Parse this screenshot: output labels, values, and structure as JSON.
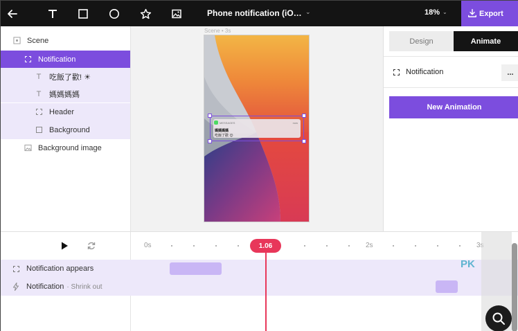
{
  "toolbar": {
    "doc_title": "Phone notification (iO…",
    "zoom": "18%",
    "export_label": "Export",
    "icons": [
      "back-arrow-icon",
      "text-tool-icon",
      "rectangle-tool-icon",
      "ellipse-tool-icon",
      "star-tool-icon",
      "image-tool-icon"
    ]
  },
  "layers": [
    {
      "label": "Scene",
      "icon": "scene-icon",
      "level": 0,
      "state": "normal"
    },
    {
      "label": "Notification",
      "icon": "group-icon",
      "level": 0,
      "state": "selected"
    },
    {
      "label": "吃飯了歡! ☀",
      "icon": "text-icon",
      "level": 1,
      "state": "child"
    },
    {
      "label": "媽媽媽媽",
      "icon": "text-icon",
      "level": 1,
      "state": "child"
    },
    {
      "label": "Header",
      "icon": "group-icon",
      "level": 1,
      "state": "child"
    },
    {
      "label": "Background",
      "icon": "box-icon",
      "level": 1,
      "state": "child"
    },
    {
      "label": "Background image",
      "icon": "image-icon",
      "level": 0,
      "state": "normal"
    }
  ],
  "canvas": {
    "scene_label": "Scene • 3s",
    "notification": {
      "app": "MESSAGES",
      "time": "now",
      "title": "媽媽媽媽",
      "body": "吃飯了歡 😊"
    }
  },
  "right_panel": {
    "tabs": [
      {
        "label": "Design",
        "active": false
      },
      {
        "label": "Animate",
        "active": true
      }
    ],
    "selected_item": "Notification",
    "more": "...",
    "new_animation": "New Animation"
  },
  "timeline": {
    "playhead": "1.06",
    "playhead_seconds": 1.06,
    "ticks": [
      "0s",
      "2s",
      "3s"
    ],
    "tracks": [
      {
        "label": "Notification appears",
        "sub": "",
        "icon": "group-icon",
        "start_s": 0.2,
        "end_s": 0.67
      },
      {
        "label": "Notification",
        "sub": "· Shrink out",
        "icon": "lightning-icon",
        "start_s": 2.6,
        "end_s": 2.8
      }
    ]
  },
  "watermark": "PK",
  "colors": {
    "accent": "#7c4dde",
    "topbar": "#141414",
    "playhead": "#e8375a",
    "clip": "#c9b6f5",
    "track_bg": "#ede8fa"
  }
}
